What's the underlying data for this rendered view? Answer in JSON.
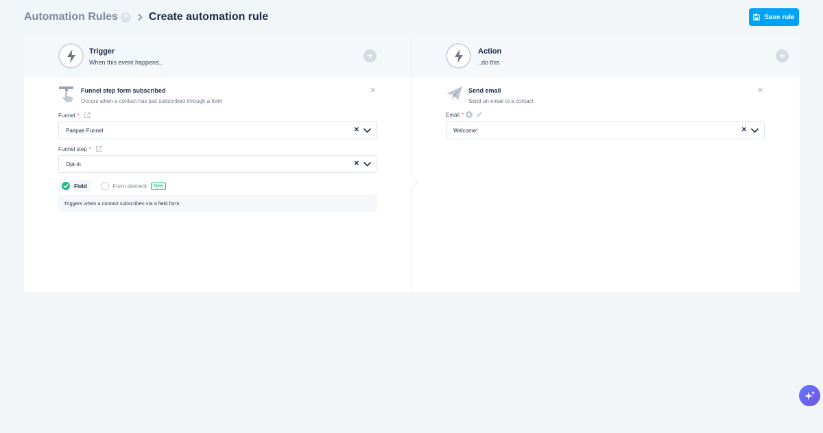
{
  "header": {
    "breadcrumb_parent": "Automation Rules",
    "help_icon": "question-mark",
    "breadcrumb_separator_icon": "chevron-right-icon",
    "page_title": "Create automation rule",
    "save_label": "Save rule"
  },
  "trigger": {
    "title": "Trigger",
    "subtitle": "When this event happens..",
    "step": {
      "title": "Funnel step form subscribed",
      "description": "Occurs when a contact has just subscribed through a form"
    },
    "funnel": {
      "label": "Funnel",
      "value": "Paepae Funnel"
    },
    "funnel_step": {
      "label": "Funnel step",
      "value": "Opt-in"
    },
    "options": {
      "field_label": "Field",
      "form_element_label": "Form element",
      "new_badge": "New",
      "selected": "Field"
    },
    "info_text": "Triggers when a contact subscribes via a field form"
  },
  "action": {
    "title": "Action",
    "subtitle": "..do this",
    "step": {
      "title": "Send email",
      "description": "Send an email to a contact"
    },
    "email": {
      "label": "Email",
      "value": "Welcome!"
    }
  },
  "colors": {
    "accent": "#00a2f5",
    "success": "#2bb58a",
    "required": "#e05263",
    "background": "#f3f6f9"
  }
}
